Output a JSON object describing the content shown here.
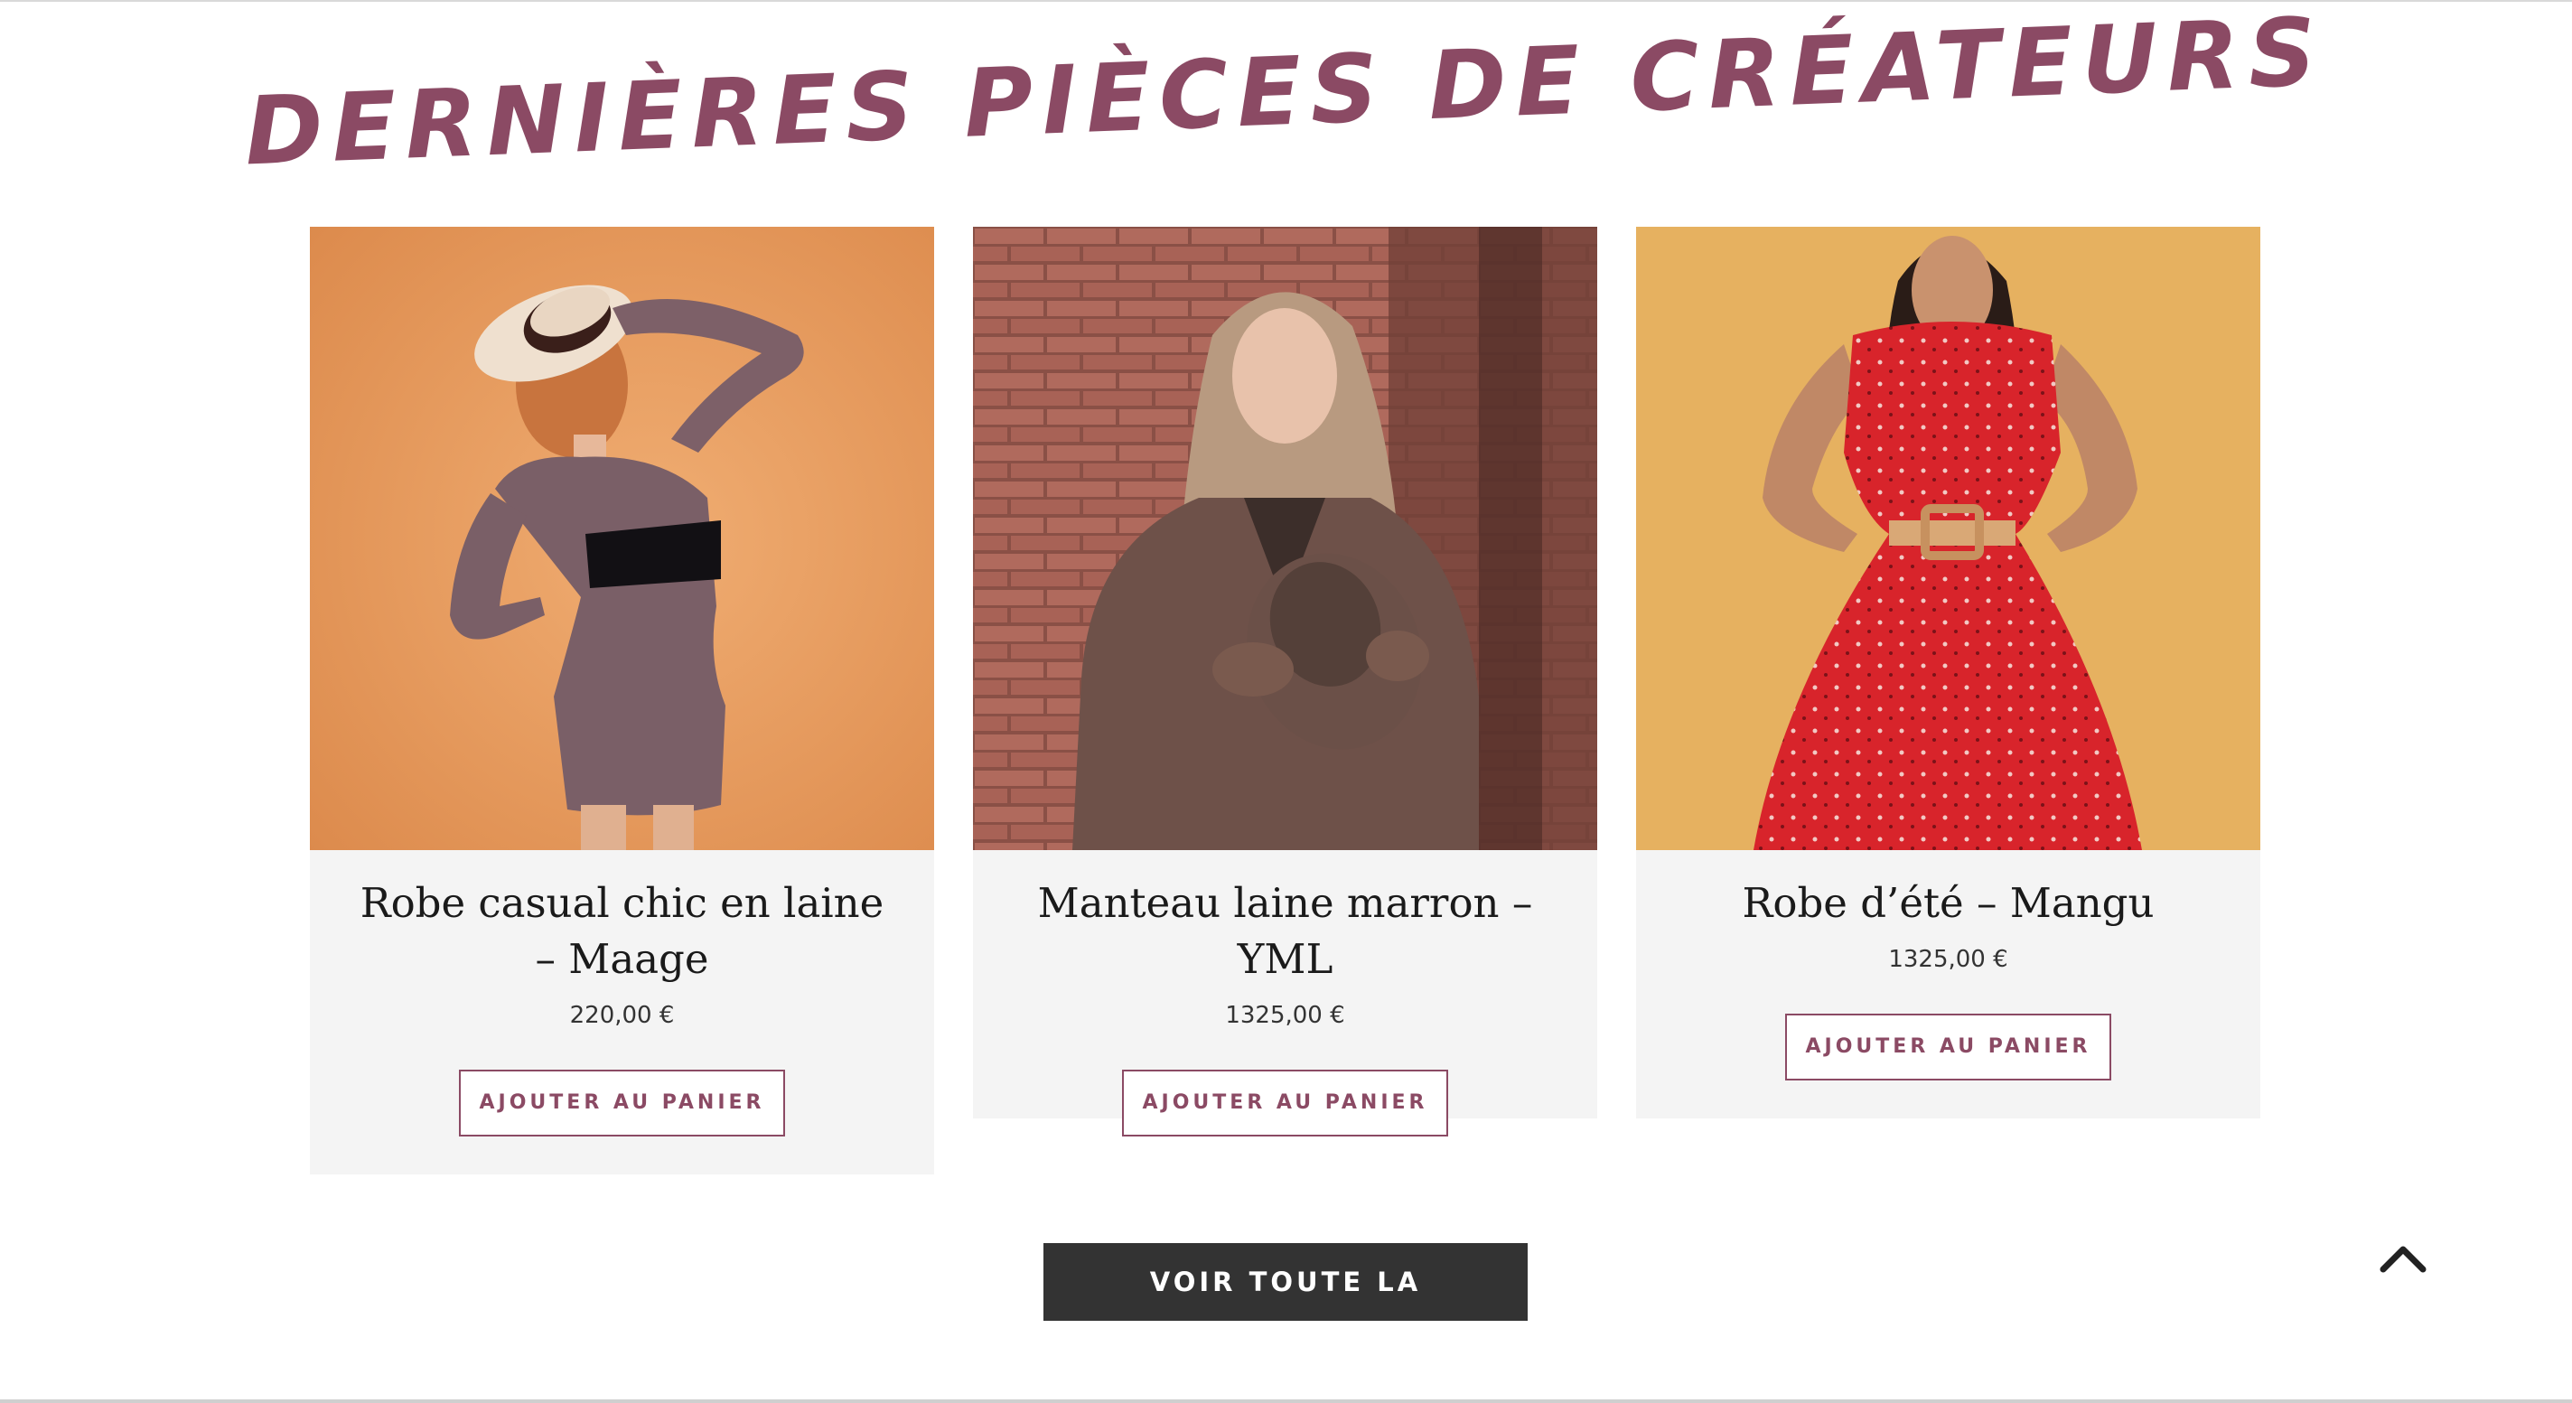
{
  "section": {
    "title": "DERNIÈRES PIÈCES DE CRÉATEURS"
  },
  "products": [
    {
      "name": "Robe casual chic en laine – Maage",
      "price": "220,00 €",
      "button_label": "AJOUTER AU PANIER",
      "image_bg": "#e59a5e"
    },
    {
      "name": "Manteau laine marron – YML",
      "price": "1325,00 €",
      "button_label": "AJOUTER AU PANIER",
      "image_bg": "#7a4b40"
    },
    {
      "name": "Robe d’été – Mangu",
      "price": "1325,00 €",
      "button_label": "AJOUTER AU PANIER",
      "image_bg": "#e6b160"
    }
  ],
  "collection_button": {
    "label": "VOIR TOUTE LA COLLECTION"
  },
  "icons": {
    "scroll_top": "chevron-up-icon"
  },
  "colors": {
    "accent": "#8b4a64",
    "card_bg": "#f4f4f4",
    "dark_button": "#333333"
  }
}
